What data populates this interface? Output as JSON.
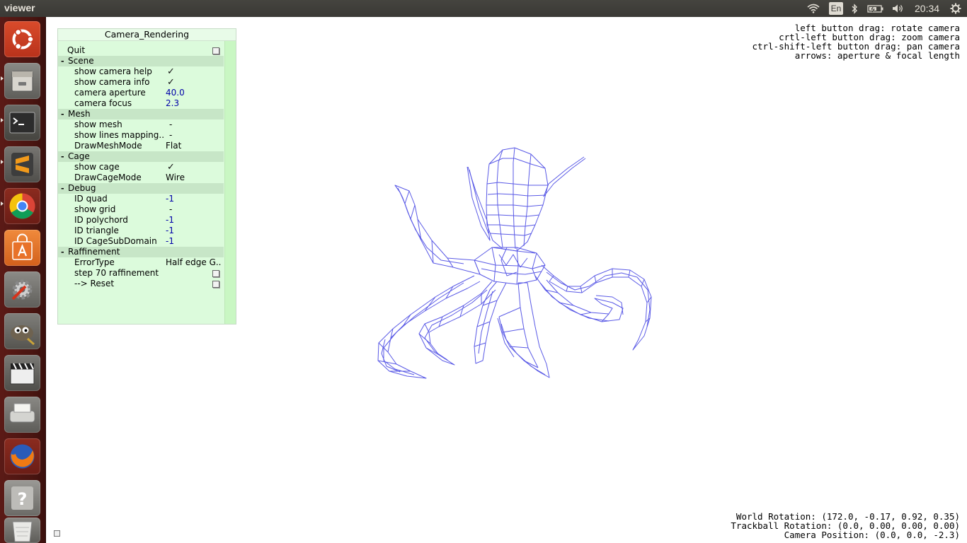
{
  "window": {
    "title": "viewer"
  },
  "tray": {
    "keyboard_layout": "En",
    "clock": "20:34"
  },
  "launcher": {
    "items": [
      {
        "name": "ubuntu-dash",
        "icon": "ubuntu-logo-icon"
      },
      {
        "name": "files",
        "icon": "file-cabinet-icon"
      },
      {
        "name": "terminal",
        "icon": "terminal-icon"
      },
      {
        "name": "sublime-text",
        "icon": "sublime-text-icon"
      },
      {
        "name": "chrome",
        "icon": "chrome-icon"
      },
      {
        "name": "software-center",
        "icon": "shopping-bag-icon"
      },
      {
        "name": "system-settings",
        "icon": "gear-wrench-icon"
      },
      {
        "name": "gimp",
        "icon": "gimp-icon"
      },
      {
        "name": "video-editor",
        "icon": "clapperboard-icon"
      },
      {
        "name": "scanner",
        "icon": "scanner-icon"
      },
      {
        "name": "firefox",
        "icon": "firefox-icon"
      },
      {
        "name": "help",
        "icon": "question-icon"
      },
      {
        "name": "trash",
        "icon": "trash-icon"
      }
    ]
  },
  "panel": {
    "title": "Camera_Rendering",
    "quit": "Quit",
    "scene": {
      "label": "Scene",
      "show_camera_help": "show camera help",
      "show_camera_help_value": "✓",
      "show_camera_info": "show camera info",
      "show_camera_info_value": "✓",
      "camera_aperture": "camera aperture",
      "camera_aperture_value": "40.0",
      "camera_focus": "camera focus",
      "camera_focus_value": "2.3"
    },
    "mesh": {
      "label": "Mesh",
      "show_mesh": "show mesh",
      "show_mesh_value": "-",
      "show_lines_mapping": "show lines mapping..",
      "show_lines_mapping_value": "-",
      "draw_mesh_mode": "DrawMeshMode",
      "draw_mesh_mode_value": "Flat"
    },
    "cage": {
      "label": "Cage",
      "show_cage": "show cage",
      "show_cage_value": "✓",
      "draw_cage_mode": "DrawCageMode",
      "draw_cage_mode_value": "Wire"
    },
    "debug": {
      "label": "Debug",
      "id_quad": "ID quad",
      "id_quad_value": "-1",
      "show_grid": "show grid",
      "show_grid_value": "-",
      "id_polychord": "ID polychord",
      "id_polychord_value": "-1",
      "id_triangle": "ID triangle",
      "id_triangle_value": "-1",
      "id_cage_subdomain": "ID CageSubDomain",
      "id_cage_subdomain_value": "-1"
    },
    "raffinement": {
      "label": "Raffinement",
      "error_type": "ErrorType",
      "error_type_value": "Half edge G..",
      "step": "step 70 raffinement",
      "reset": "--> Reset"
    }
  },
  "help_lines": {
    "l1": "left button drag: rotate camera",
    "l2": "crtl-left button drag: zoom camera",
    "l3": "ctrl-shift-left button drag: pan camera",
    "l4": "arrows: aperture & focal length"
  },
  "info_lines": {
    "world_rotation": "World Rotation: (172.0, -0.17, 0.92, 0.35)",
    "trackball_rotation": "Trackball Rotation: (0.0, 0.00, 0.00, 0.00)",
    "camera_position": "Camera Position: (0.0, 0.0, -2.3)"
  },
  "colors": {
    "wireframe": "#5a5ae6",
    "panel_bg": "#dcfbdc",
    "launcher_bg": "#4a1511"
  }
}
